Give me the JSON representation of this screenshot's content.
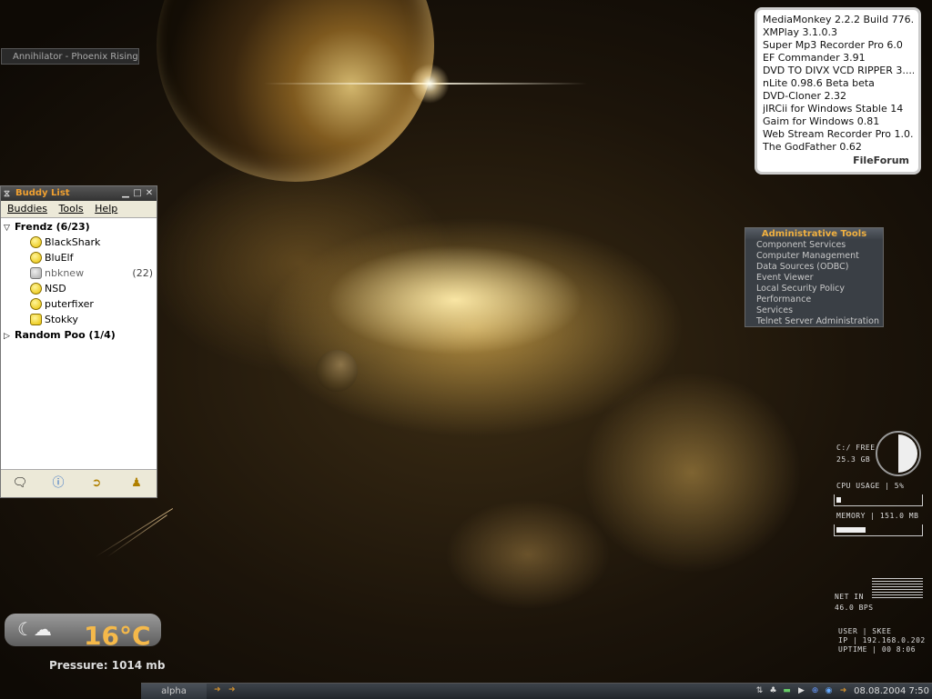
{
  "winamp": {
    "title": "Annihilator - Phoenix Rising"
  },
  "buddy_list": {
    "title": "Buddy List",
    "menu": [
      "Buddies",
      "Tools",
      "Help"
    ],
    "groups": [
      {
        "name": "Frendz (6/23)",
        "expanded": true,
        "buddies": [
          {
            "name": "BlackShark",
            "status": "online",
            "idle": ""
          },
          {
            "name": "BluElf",
            "status": "online",
            "idle": ""
          },
          {
            "name": "nbknew",
            "status": "idle",
            "idle": "(22)"
          },
          {
            "name": "NSD",
            "status": "online",
            "idle": ""
          },
          {
            "name": "puterfixer",
            "status": "online",
            "idle": ""
          },
          {
            "name": "Stokky",
            "status": "away",
            "idle": ""
          }
        ]
      },
      {
        "name": "Random Poo (1/4)",
        "expanded": false,
        "buddies": []
      }
    ],
    "toolbar_icons": [
      "im-icon",
      "info-icon",
      "chat-icon",
      "away-icon"
    ]
  },
  "fileforum": {
    "items": [
      "MediaMonkey 2.2.2 Build 776...",
      "XMPlay 3.1.0.3",
      "Super Mp3 Recorder Pro 6.0",
      "EF Commander 3.91",
      "DVD TO DIVX VCD RIPPER 3....",
      "nLite 0.98.6 Beta beta",
      "DVD-Cloner 2.32",
      "jIRCii for Windows Stable 14",
      "Gaim for Windows 0.81",
      "Web Stream Recorder Pro 1.0...",
      "The GodFather 0.62"
    ],
    "brand": "FileForum"
  },
  "admin_tools": {
    "title": "Administrative Tools",
    "items": [
      "Component Services",
      "Computer Management",
      "Data Sources (ODBC)",
      "Event Viewer",
      "Local Security Policy",
      "Performance",
      "Services",
      "Telnet Server Administration"
    ]
  },
  "stats": {
    "disk_label": "C:/ FREE",
    "disk_value": "25.3 GB",
    "cpu_label": "CPU USAGE | 5%",
    "cpu_percent": 5,
    "memory_label": "MEMORY | 151.0 MB",
    "memory_percent": 35,
    "net_label": "NET IN",
    "net_value": "46.0 BPS",
    "user_line": "USER | SKEE",
    "ip_line": "IP | 192.168.0.202",
    "uptime_line": "UPTIME | 00 8:06"
  },
  "weather": {
    "temperature": "16°C",
    "pressure_label": "Pressure:",
    "pressure_value": "1014 mb"
  },
  "taskbar": {
    "button": "alpha",
    "clock": "08.08.2004 7:50"
  }
}
